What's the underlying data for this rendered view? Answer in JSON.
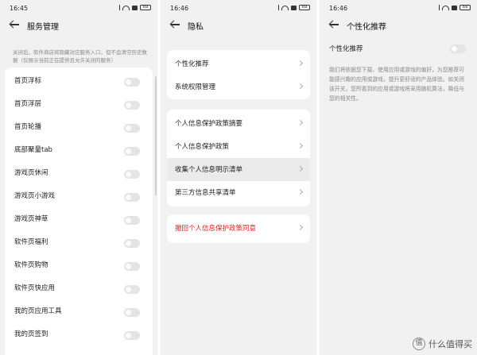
{
  "panels": [
    {
      "status_time": "16:45",
      "battery": "69",
      "title": "服务管理",
      "note": "关闭后，软件商店将隐藏对应服务入口，但不会清空历史数据（仅展示当前正在提供且允许关闭的服务）",
      "items": [
        {
          "label": "首页浮标"
        },
        {
          "label": "首页浮层"
        },
        {
          "label": "首页轮播"
        },
        {
          "label": "底部聚量tab"
        },
        {
          "label": "游戏页休闲"
        },
        {
          "label": "游戏页小游戏"
        },
        {
          "label": "游戏页神草"
        },
        {
          "label": "软件页福利"
        },
        {
          "label": "软件页购物"
        },
        {
          "label": "软件页快应用"
        },
        {
          "label": "我的页应用工具"
        },
        {
          "label": "我的页签到"
        }
      ]
    },
    {
      "status_time": "16:46",
      "battery": "69",
      "title": "隐私",
      "group1": [
        {
          "label": "个性化推荐"
        },
        {
          "label": "系统权限管理"
        }
      ],
      "group2": [
        {
          "label": "个人信息保护政策摘要"
        },
        {
          "label": "个人信息保护政策"
        },
        {
          "label": "收集个人信息明示清单"
        },
        {
          "label": "第三方信息共享清单"
        }
      ],
      "group3": [
        {
          "label": "撤回个人信息保护政策同意"
        }
      ]
    },
    {
      "status_time": "16:46",
      "battery": "69",
      "title": "个性化推荐",
      "toggle_label": "个性化推荐",
      "description": "我们将依据您下载、使用应用或游戏的偏好，为您推荐可能感兴趣的应用或游戏，提升更舒适的产品体验。如关闭该开关，您所看到的应用或游戏将采用随机算法，降低与您的相关性。"
    }
  ],
  "toggles_state": "off",
  "accent_red": "#e02020",
  "watermark": "什么值得买",
  "watermark_icon_glyph": "值"
}
